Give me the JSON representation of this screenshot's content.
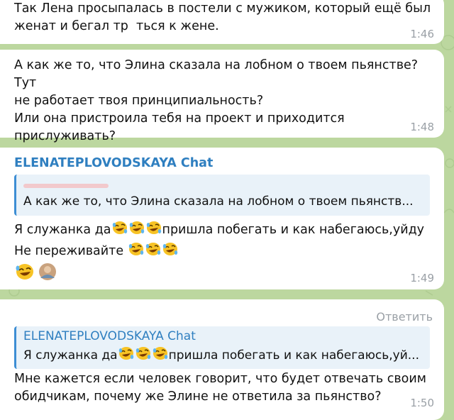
{
  "messages": [
    {
      "text": "Так Лена просыпалась в постели с мужиком, который ещё был\nженат и бегал тр  ться к жене.",
      "time": "1:46"
    },
    {
      "text": "А как же то, что Элина сказала на лобном о твоем пьянстве? Тут\nне работает твоя принципиальность?\nИли она пристроила тебя на проект и приходится\nприслуживать?",
      "time": "1:48"
    },
    {
      "sender": "ELENATEPLOVODSKAYA Chat",
      "quote_sender": "",
      "quote_text": "А как же то, что Элина сказала на лобном о твоем пьянств...",
      "line1_a": "Я служанка да",
      "line1_b": "пришла  побегать и как набегаюсь,уйду",
      "line2": "Не переживайте ",
      "time": "1:49",
      "reactions": [
        "rofl-emoji",
        "avatar"
      ]
    },
    {
      "reply_label": "Ответить",
      "quote_sender": "ELENATEPLOVODSKAYA Chat",
      "quote_a": "Я служанка да",
      "quote_b": "пришла  побегать и как набегаюсь,уй...",
      "text": "Мне кажется если человек говорит, что будет отвечать своим\nобидчикам, почему же Элине не ответила за пьянство?",
      "time": "1:50"
    }
  ],
  "icons": {
    "emoji": "rolling-on-floor-laughing-emoji"
  }
}
